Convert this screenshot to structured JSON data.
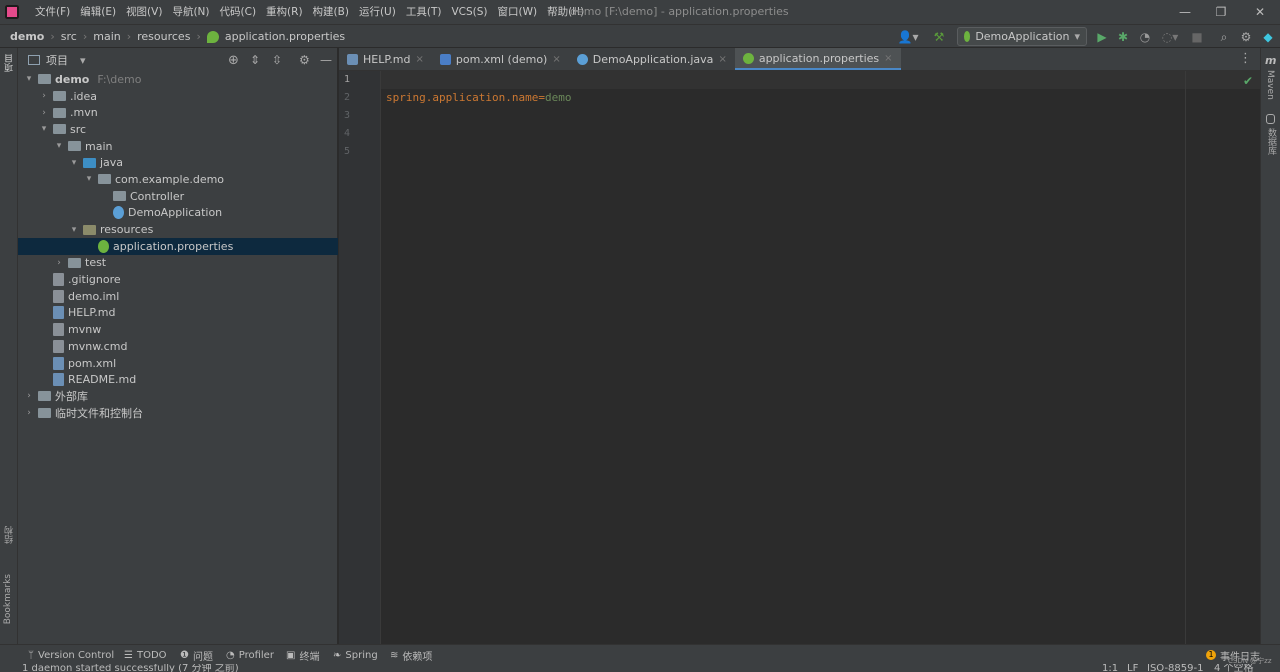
{
  "titlebar": {
    "menus": [
      "文件(F)",
      "编辑(E)",
      "视图(V)",
      "导航(N)",
      "代码(C)",
      "重构(R)",
      "构建(B)",
      "运行(U)",
      "工具(T)",
      "VCS(S)",
      "窗口(W)",
      "帮助(H)"
    ],
    "window_title": "demo [F:\\demo] - application.properties",
    "minimize": "—",
    "restore": "❐",
    "close": "✕"
  },
  "navbar": {
    "breadcrumbs": [
      "demo",
      "src",
      "main",
      "resources",
      "application.properties"
    ],
    "run_config": "DemoApplication"
  },
  "project_panel": {
    "title": "项目",
    "tree": [
      {
        "label": "demo",
        "extra": "F:\\demo",
        "arrow": "▾",
        "indent": 0,
        "icon": "module-folder"
      },
      {
        "label": ".idea",
        "arrow": "›",
        "indent": 1,
        "icon": "folder"
      },
      {
        "label": ".mvn",
        "arrow": "›",
        "indent": 1,
        "icon": "folder"
      },
      {
        "label": "src",
        "arrow": "▾",
        "indent": 1,
        "icon": "folder"
      },
      {
        "label": "main",
        "arrow": "▾",
        "indent": 2,
        "icon": "folder"
      },
      {
        "label": "java",
        "arrow": "▾",
        "indent": 3,
        "icon": "source-folder"
      },
      {
        "label": "com.example.demo",
        "arrow": "▾",
        "indent": 4,
        "icon": "package"
      },
      {
        "label": "Controller",
        "arrow": "",
        "indent": 5,
        "icon": "package"
      },
      {
        "label": "DemoApplication",
        "arrow": "",
        "indent": 5,
        "icon": "spring-class"
      },
      {
        "label": "resources",
        "arrow": "▾",
        "indent": 3,
        "icon": "resources-folder"
      },
      {
        "label": "application.properties",
        "arrow": "",
        "indent": 4,
        "icon": "spring-properties",
        "selected": true
      },
      {
        "label": "test",
        "arrow": "›",
        "indent": 2,
        "icon": "folder"
      },
      {
        "label": ".gitignore",
        "arrow": "",
        "indent": 1,
        "icon": "file"
      },
      {
        "label": "demo.iml",
        "arrow": "",
        "indent": 1,
        "icon": "file"
      },
      {
        "label": "HELP.md",
        "arrow": "",
        "indent": 1,
        "icon": "md-file"
      },
      {
        "label": "mvnw",
        "arrow": "",
        "indent": 1,
        "icon": "file"
      },
      {
        "label": "mvnw.cmd",
        "arrow": "",
        "indent": 1,
        "icon": "file"
      },
      {
        "label": "pom.xml",
        "arrow": "",
        "indent": 1,
        "icon": "maven-file"
      },
      {
        "label": "README.md",
        "arrow": "",
        "indent": 1,
        "icon": "md-file"
      },
      {
        "label": "外部库",
        "arrow": "›",
        "indent": 0,
        "icon": "library"
      },
      {
        "label": "临时文件和控制台",
        "arrow": "›",
        "indent": 0,
        "icon": "scratch"
      }
    ]
  },
  "editor": {
    "tabs": [
      {
        "label": "HELP.md",
        "icon": "md-file"
      },
      {
        "label": "pom.xml (demo)",
        "icon": "maven-file"
      },
      {
        "label": "DemoApplication.java",
        "icon": "spring-class"
      },
      {
        "label": "application.properties",
        "icon": "spring-properties",
        "active": true
      }
    ],
    "line_numbers": [
      "1",
      "2",
      "3",
      "4",
      "5"
    ],
    "code": {
      "key": "spring.application.name",
      "eq": "=",
      "value": "demo"
    }
  },
  "left_stripe": {
    "project": "项目",
    "structure": "结构",
    "bookmarks": "Bookmarks"
  },
  "right_stripe": {
    "maven": "Maven",
    "database": "数据库"
  },
  "toolwindows": [
    "Version Control",
    "TODO",
    "问题",
    "Profiler",
    "终端",
    "Spring",
    "依赖项"
  ],
  "event_log": "事件日志",
  "status": {
    "message": "1 daemon started successfully (7 分钟 之前)",
    "position": "1:1",
    "line_sep": "LF",
    "encoding": "ISO-8859-1",
    "indent": "4 个空格",
    "watermark": "CSDN @宁zz"
  },
  "colors": {
    "key": "#cc7832",
    "value": "#6a8759",
    "selection": "#0d293e",
    "accent": "#4a88c7"
  }
}
